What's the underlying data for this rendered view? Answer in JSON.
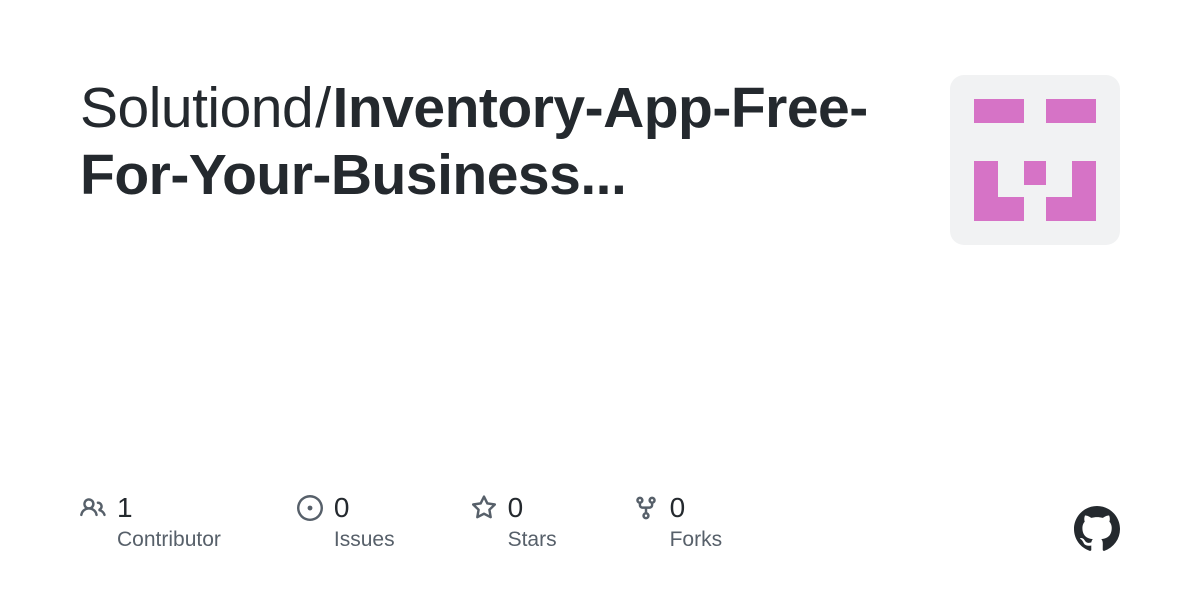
{
  "repo": {
    "owner": "Solutiond",
    "separator": "/",
    "name": "Inventory-App-Free-For-Your-Business...",
    "avatar_color": "#d673c6",
    "avatar_bg": "#f1f2f3"
  },
  "stats": {
    "contributors": {
      "count": "1",
      "label": "Contributor"
    },
    "issues": {
      "count": "0",
      "label": "Issues"
    },
    "stars": {
      "count": "0",
      "label": "Stars"
    },
    "forks": {
      "count": "0",
      "label": "Forks"
    }
  }
}
